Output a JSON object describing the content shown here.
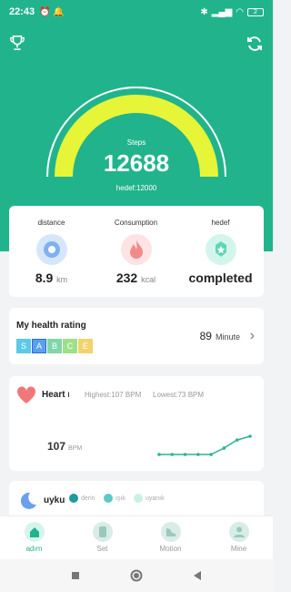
{
  "status": {
    "time": "22:43",
    "battery": "2"
  },
  "hero": {
    "label": "Steps",
    "value": "12688",
    "goal": "hedef:12000",
    "progress": 1.0
  },
  "stats": [
    {
      "label": "distance",
      "value": "8.9",
      "unit": "km"
    },
    {
      "label": "Consumption",
      "value": "232",
      "unit": "kcal"
    },
    {
      "label": "hedef",
      "value": "completed",
      "unit": ""
    }
  ],
  "health": {
    "title": "My health rating",
    "grades": [
      "S",
      "A",
      "B",
      "C",
      "E"
    ],
    "selected_grade": "A",
    "minutes": "89",
    "minutes_unit": "Minute"
  },
  "heart": {
    "title": "Heart rate",
    "highest": "Highest:107  BPM",
    "lowest": "Lowest:73  BPM",
    "bpm": "107",
    "bpm_unit": "BPM",
    "series": [
      73,
      73,
      73,
      73,
      73,
      85,
      100,
      107
    ]
  },
  "sleep": {
    "title": "uyku",
    "legend": [
      "derin",
      "ışık",
      "uyanık"
    ]
  },
  "tabs": [
    "adım",
    "Set",
    "Motion",
    "Mine"
  ],
  "colors": {
    "brand": "#21b48c",
    "gauge": "#e6f537"
  }
}
